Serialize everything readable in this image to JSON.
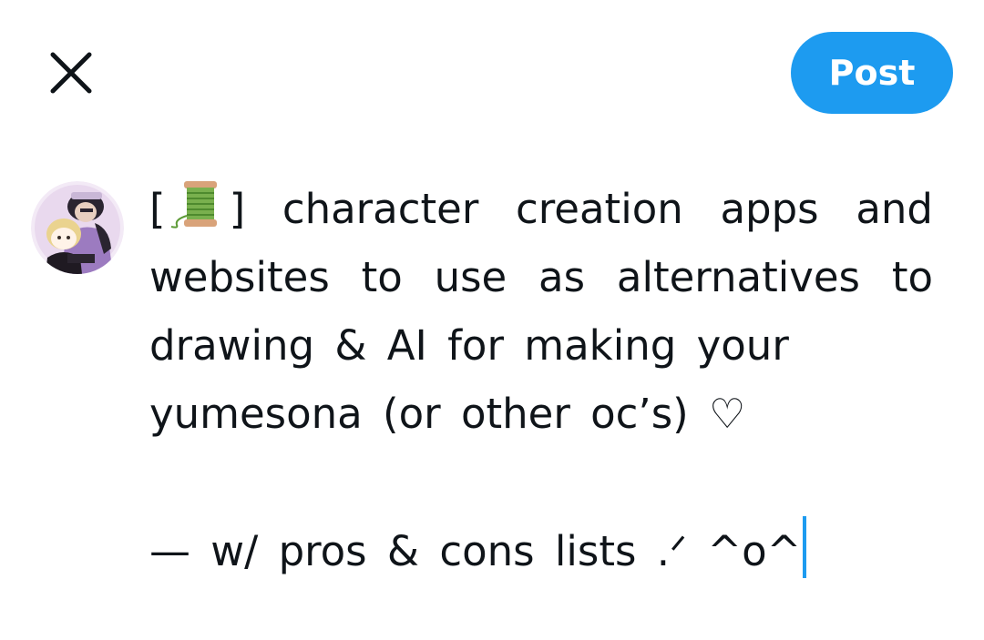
{
  "colors": {
    "accent": "#1d9bf0",
    "text": "#0f1419"
  },
  "header": {
    "close_icon": "close-icon",
    "post_label": "Post"
  },
  "composer": {
    "line1_prefix": "[",
    "line1_spool_icon": "thread-spool-icon",
    "line1_suffix": "]",
    "line1_text": "character creation apps and",
    "line2": "websites to use as alternatives to",
    "line3": "drawing & AI for making your",
    "line4": "yumesona (or other oc’s) ♡",
    "line5": "— w/ pros & cons lists .ᐟ  ^o^"
  }
}
